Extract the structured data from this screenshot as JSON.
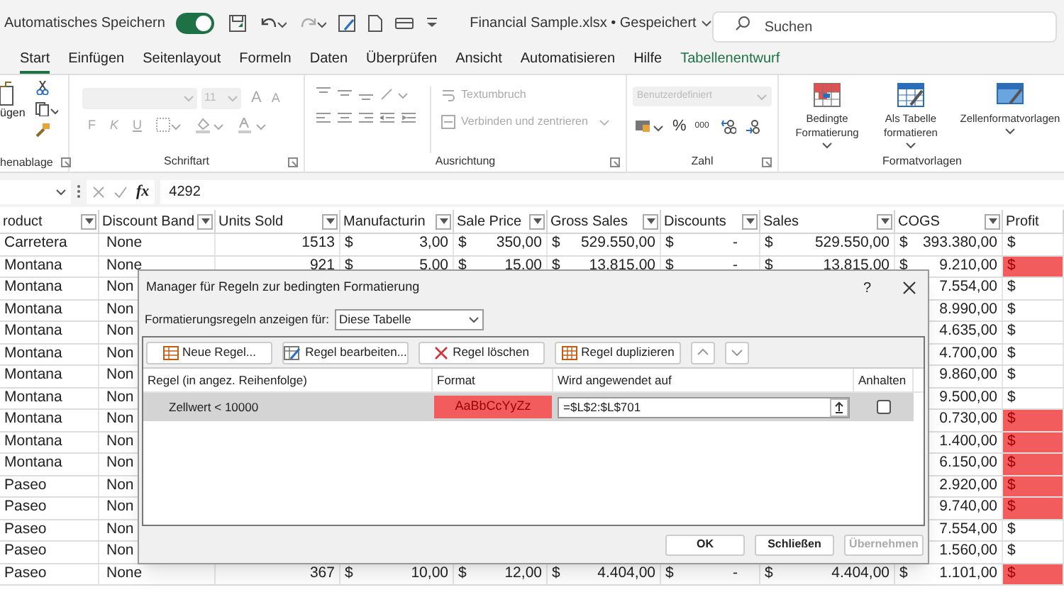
{
  "title_bar": {
    "autosave_label": "Automatisches Speichern",
    "autosave_on": true,
    "file_title": "Financial Sample.xlsx • Gespeichert",
    "search_placeholder": "Suchen"
  },
  "ribbon": {
    "tabs": [
      {
        "label": "Start",
        "selected": true,
        "kind": "normal"
      },
      {
        "label": "Einfügen",
        "selected": false,
        "kind": "normal"
      },
      {
        "label": "Seitenlayout",
        "selected": false,
        "kind": "normal"
      },
      {
        "label": "Formeln",
        "selected": false,
        "kind": "normal"
      },
      {
        "label": "Daten",
        "selected": false,
        "kind": "normal"
      },
      {
        "label": "Überprüfen",
        "selected": false,
        "kind": "normal"
      },
      {
        "label": "Ansicht",
        "selected": false,
        "kind": "normal"
      },
      {
        "label": "Automatisieren",
        "selected": false,
        "kind": "normal"
      },
      {
        "label": "Hilfe",
        "selected": false,
        "kind": "normal"
      },
      {
        "label": "Tabellenentwurf",
        "selected": false,
        "kind": "contextual"
      }
    ],
    "clipboard": {
      "paste_label": "ügen",
      "group_label": "henablage"
    },
    "font": {
      "size": "11",
      "grow": "A",
      "shrink": "A",
      "bold": "F",
      "italic": "K",
      "underline": "U",
      "group_label": "Schriftart"
    },
    "alignment": {
      "wrap_text": "Textumbruch",
      "merge_center": "Verbinden und zentrieren",
      "group_label": "Ausrichtung"
    },
    "number": {
      "format": "Benutzerdefiniert",
      "percent": "%",
      "thousands": "000",
      "group_label": "Zahl"
    },
    "styles": {
      "buttons": [
        {
          "label": "Bedingte Formatierung",
          "kind": "conditional"
        },
        {
          "label": "Als Tabelle formatieren",
          "kind": "table"
        },
        {
          "label": "Zellenformatvorlagen",
          "kind": "cell"
        }
      ],
      "group_label": "Formatvorlagen"
    }
  },
  "formula_bar": {
    "function_label": "fx",
    "value": "4292"
  },
  "grid": {
    "columns": [
      "roduct",
      "Discount Band",
      "Units Sold",
      "Manufacturin",
      "Sale Price",
      "Gross Sales",
      "Discounts",
      "Sales",
      "COGS",
      "Profit"
    ],
    "rows": [
      {
        "product": "Carretera",
        "discount_band": "None",
        "units_sold": "1513",
        "manufacturing_price": {
          "sign": "$",
          "amount": "3,00"
        },
        "sale_price": {
          "sign": "$",
          "amount": "350,00"
        },
        "gross_sales": {
          "sign": "$",
          "amount": "529.550,00"
        },
        "discounts": {
          "sign": "$",
          "amount": "-"
        },
        "sales": {
          "sign": "$",
          "amount": "529.550,00"
        },
        "cogs": {
          "sign": "$",
          "amount": "393.380,00"
        },
        "profit": {
          "sign": "$",
          "highlighted": false
        }
      },
      {
        "product": "Montana",
        "discount_band": "None",
        "units_sold": "921",
        "manufacturing_price": {
          "sign": "$",
          "amount": "5,00"
        },
        "sale_price": {
          "sign": "$",
          "amount": "15,00"
        },
        "gross_sales": {
          "sign": "$",
          "amount": "13.815,00"
        },
        "discounts": {
          "sign": "$",
          "amount": "-"
        },
        "sales": {
          "sign": "$",
          "amount": "13.815,00"
        },
        "cogs": {
          "sign": "$",
          "amount": "9.210,00"
        },
        "profit": {
          "sign": "$",
          "highlighted": true
        }
      },
      {
        "product": "Montana",
        "discount_band": "Non",
        "cogs": {
          "amount": "7.554,00"
        },
        "profit": {
          "sign": "$",
          "highlighted": false
        }
      },
      {
        "product": "Montana",
        "discount_band": "Non",
        "cogs": {
          "amount": "8.990,00"
        },
        "profit": {
          "sign": "$",
          "highlighted": false
        }
      },
      {
        "product": "Montana",
        "discount_band": "Non",
        "cogs": {
          "amount": "4.635,00"
        },
        "profit": {
          "sign": "$",
          "highlighted": false
        }
      },
      {
        "product": "Montana",
        "discount_band": "Non",
        "cogs": {
          "amount": "4.700,00"
        },
        "profit": {
          "sign": "$",
          "highlighted": false
        }
      },
      {
        "product": "Montana",
        "discount_band": "Non",
        "cogs": {
          "amount": "9.860,00"
        },
        "profit": {
          "sign": "$",
          "highlighted": false
        }
      },
      {
        "product": "Montana",
        "discount_band": "Non",
        "cogs": {
          "amount": "9.500,00"
        },
        "profit": {
          "sign": "$",
          "highlighted": false
        }
      },
      {
        "product": "Montana",
        "discount_band": "Non",
        "cogs": {
          "amount": "0.730,00"
        },
        "profit": {
          "sign": "$",
          "highlighted": true
        }
      },
      {
        "product": "Montana",
        "discount_band": "Non",
        "cogs": {
          "amount": "1.400,00"
        },
        "profit": {
          "sign": "$",
          "highlighted": true
        }
      },
      {
        "product": "Montana",
        "discount_band": "Non",
        "cogs": {
          "amount": "6.150,00"
        },
        "profit": {
          "sign": "$",
          "highlighted": true
        }
      },
      {
        "product": "Paseo",
        "discount_band": "Non",
        "cogs": {
          "amount": "2.920,00"
        },
        "profit": {
          "sign": "$",
          "highlighted": true
        }
      },
      {
        "product": "Paseo",
        "discount_band": "Non",
        "cogs": {
          "amount": "9.740,00"
        },
        "profit": {
          "sign": "$",
          "highlighted": true
        }
      },
      {
        "product": "Paseo",
        "discount_band": "Non",
        "cogs": {
          "amount": "7.554,00"
        },
        "profit": {
          "sign": "$",
          "highlighted": false
        }
      },
      {
        "product": "Paseo",
        "discount_band": "Non",
        "cogs": {
          "amount": "1.560,00"
        },
        "profit": {
          "sign": "$",
          "highlighted": false
        }
      },
      {
        "product": "Paseo",
        "discount_band": "None",
        "units_sold": "367",
        "manufacturing_price": {
          "sign": "$",
          "amount": "10,00"
        },
        "sale_price": {
          "sign": "$",
          "amount": "12,00"
        },
        "gross_sales": {
          "sign": "$",
          "amount": "4.404,00"
        },
        "discounts": {
          "sign": "$",
          "amount": "-"
        },
        "sales": {
          "sign": "$",
          "amount": "4.404,00"
        },
        "cogs": {
          "sign": "$",
          "amount": "1.101,00"
        },
        "profit": {
          "sign": "$",
          "highlighted": true
        }
      }
    ]
  },
  "dialog": {
    "title": "Manager für Regeln zur bedingten Formatierung",
    "help": "?",
    "scope_label": "Formatierungsregeln anzeigen für:",
    "scope": "Diese Tabelle",
    "toolbar": [
      {
        "label": "Neue Regel...",
        "kind": "new"
      },
      {
        "label": "Regel bearbeiten...",
        "kind": "edit"
      },
      {
        "label": "Regel löschen",
        "kind": "delete"
      },
      {
        "label": "Regel duplizieren",
        "kind": "duplicate"
      },
      {
        "kind": "up"
      },
      {
        "kind": "down"
      }
    ],
    "columns": [
      "Regel (in angez. Reihenfolge)",
      "Format",
      "Wird angewendet auf",
      "Anhalten"
    ],
    "rules": [
      {
        "rule": "Zellwert < 10000",
        "format_sample": "AaBbCcYyZz",
        "applies_to": "=$L$2:$L$701",
        "stop_if_true": false,
        "selected": true
      }
    ],
    "buttons": [
      {
        "label": "OK",
        "disabled": false
      },
      {
        "label": "Schließen",
        "disabled": false
      },
      {
        "label": "Übernehmen",
        "disabled": true
      }
    ]
  }
}
